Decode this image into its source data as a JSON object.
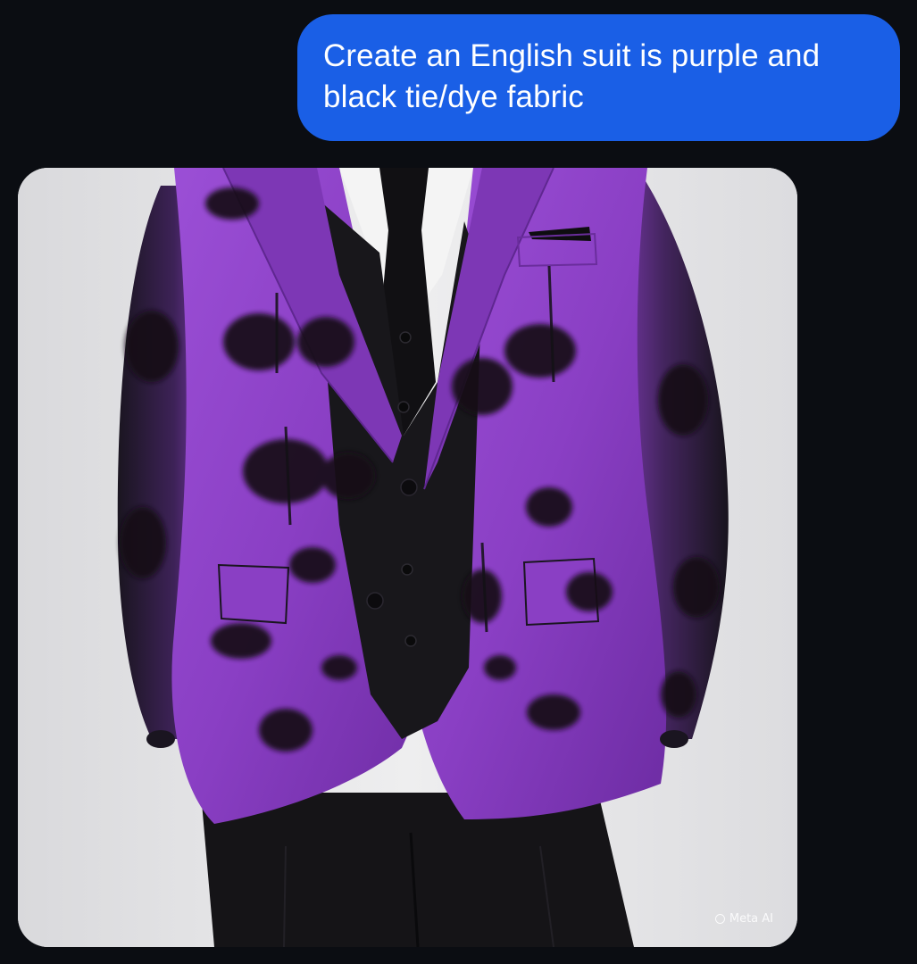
{
  "chat": {
    "user_message": "Create an English suit is purple and black tie/dye fabric"
  },
  "generated_image": {
    "subject": "suit",
    "watermark": "Meta AI",
    "colors": {
      "background": "#e6e6e8",
      "suit_purple": "#8a3fc4",
      "suit_black": "#141316",
      "shirt": "#f4f4f4"
    }
  },
  "theme": {
    "page_background": "#0b0d12",
    "bubble_color": "#1a5fe6",
    "bubble_text": "#ffffff"
  }
}
